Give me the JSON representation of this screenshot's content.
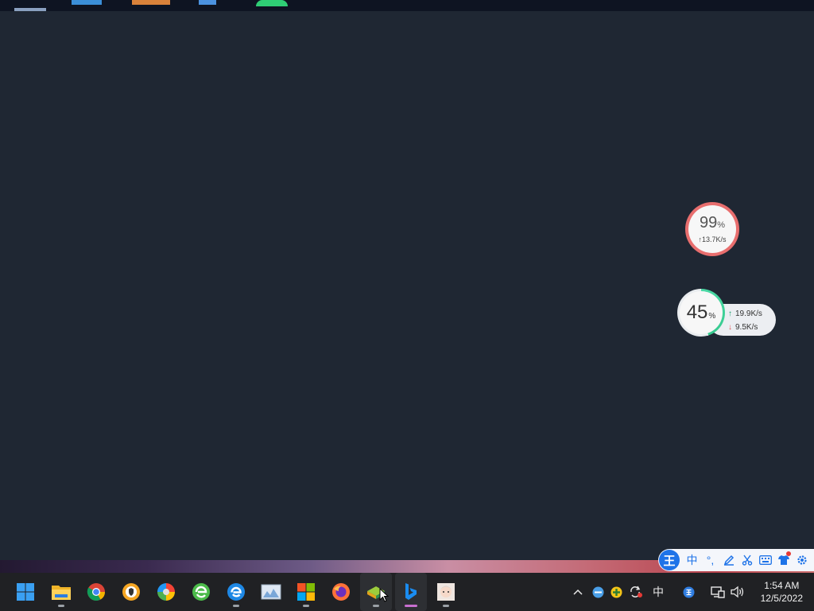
{
  "widget_cpu": {
    "percent": "99",
    "percent_unit": "%",
    "upload": "↑13.7K/s"
  },
  "widget_mem": {
    "percent": "45",
    "percent_unit": "%",
    "up_speed": "19.9K/s",
    "down_speed": "9.5K/s",
    "fill_fraction": 0.45
  },
  "ime": {
    "logo": "王",
    "buttons": [
      "中",
      "°,",
      "pen",
      "scissors",
      "keyboard",
      "skin",
      "settings"
    ]
  },
  "taskbar": {
    "apps": [
      "windows-start",
      "file-explorer",
      "chrome",
      "browser-shield",
      "color-wheel",
      "360-browser",
      "ie-browser",
      "image-viewer",
      "microsoft-store",
      "firefox",
      "game-launcher",
      "bing",
      "anime-app"
    ]
  },
  "tray": {
    "ime_indicator": "中",
    "time": "1:54 AM",
    "date": "12/5/2022"
  }
}
